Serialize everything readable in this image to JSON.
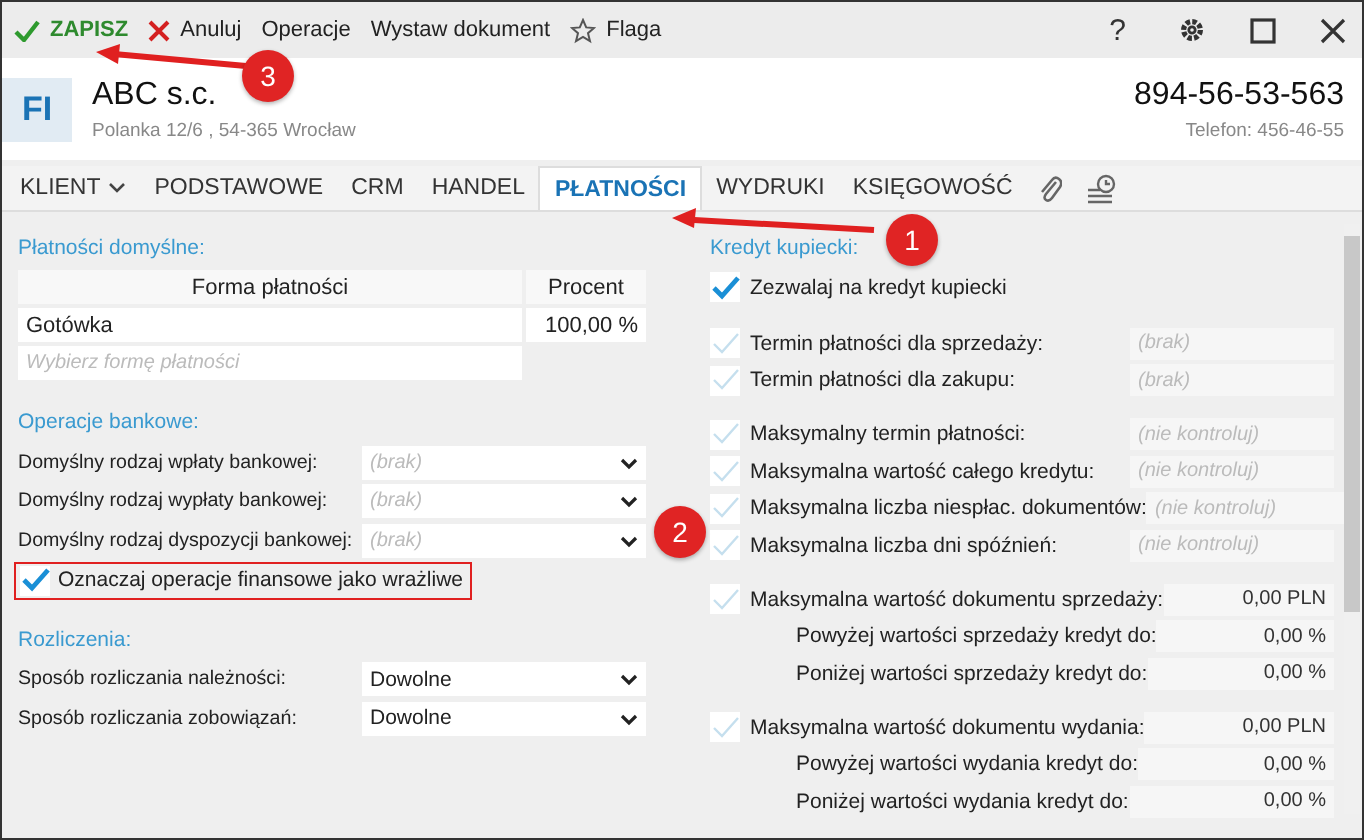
{
  "toolbar": {
    "items": [
      {
        "kind": "save",
        "label": "ZAPISZ"
      },
      {
        "kind": "cancel",
        "label": "Anuluj"
      },
      {
        "kind": "text",
        "label": "Operacje"
      },
      {
        "kind": "text",
        "label": "Wystaw dokument"
      },
      {
        "kind": "flag",
        "label": "Flaga"
      }
    ],
    "help": "?"
  },
  "header": {
    "initials": "FI",
    "name": "ABC s.c.",
    "address": "Polanka  12/6 , 54-365 Wrocław",
    "nip": "894-56-53-563",
    "phone": "Telefon: 456-46-55"
  },
  "tabs": [
    {
      "kind": "menu",
      "label": "KLIENT",
      "selected": false
    },
    {
      "kind": "text",
      "label": "PODSTAWOWE",
      "selected": false
    },
    {
      "kind": "text",
      "label": "CRM",
      "selected": false
    },
    {
      "kind": "text",
      "label": "HANDEL",
      "selected": false
    },
    {
      "kind": "text",
      "label": "PŁATNOŚCI",
      "selected": true
    },
    {
      "kind": "text",
      "label": "WYDRUKI",
      "selected": false
    },
    {
      "kind": "text",
      "label": "KSIĘGOWOŚĆ",
      "selected": false
    },
    {
      "kind": "attachment",
      "selected": false
    },
    {
      "kind": "history",
      "selected": false
    }
  ],
  "default_payments": {
    "title": "Płatności domyślne:",
    "columns": [
      "Forma płatności",
      "Procent"
    ],
    "rows": [
      {
        "method": "Gotówka",
        "percent": "100,00 %"
      }
    ],
    "placeholder": "Wybierz formę płatności"
  },
  "bank_operations": {
    "title": "Operacje bankowe:",
    "fields": [
      {
        "label": "Domyślny rodzaj wpłaty bankowej:",
        "placeholder": "(brak)"
      },
      {
        "label": "Domyślny rodzaj wypłaty bankowej:",
        "placeholder": "(brak)"
      },
      {
        "label": "Domyślny rodzaj dyspozycji bankowej:",
        "placeholder": "(brak)"
      }
    ],
    "sensitive": {
      "label": "Oznaczaj operacje finansowe jako wrażliwe",
      "checked": true,
      "highlighted": true
    }
  },
  "settlements": {
    "title": "Rozliczenia:",
    "fields": [
      {
        "label": "Sposób rozliczania należności:",
        "value": "Dowolne"
      },
      {
        "label": "Sposób rozliczania zobowiązań:",
        "value": "Dowolne"
      }
    ]
  },
  "credit": {
    "title": "Kredyt kupiecki:",
    "allow": {
      "label": "Zezwalaj na kredyt kupiecki",
      "checked": true
    },
    "groups": [
      [
        {
          "kind": "check",
          "label": "Termin płatności dla sprzedaży:",
          "checked": false,
          "placeholder": "(brak)"
        },
        {
          "kind": "check",
          "label": "Termin płatności dla zakupu:",
          "checked": false,
          "placeholder": "(brak)"
        }
      ],
      [
        {
          "kind": "check",
          "label": "Maksymalny termin płatności:",
          "checked": false,
          "placeholder": "(nie kontroluj)"
        },
        {
          "kind": "check",
          "label": "Maksymalna wartość całego kredytu:",
          "checked": false,
          "placeholder": "(nie kontroluj)"
        },
        {
          "kind": "check",
          "label": "Maksymalna liczba niespłac. dokumentów:",
          "checked": false,
          "placeholder": "(nie kontroluj)"
        },
        {
          "kind": "check",
          "label": "Maksymalna liczba dni spóźnień:",
          "checked": false,
          "placeholder": "(nie kontroluj)"
        }
      ],
      [
        {
          "kind": "check",
          "label": "Maksymalna wartość dokumentu sprzedaży:",
          "checked": false,
          "value": "0,00 PLN"
        },
        {
          "kind": "sub",
          "label": "Powyżej wartości sprzedaży kredyt do:",
          "value": "0,00 %"
        },
        {
          "kind": "sub",
          "label": "Poniżej wartości sprzedaży kredyt do:",
          "value": "0,00 %"
        }
      ],
      [
        {
          "kind": "check",
          "label": "Maksymalna wartość dokumentu wydania:",
          "checked": false,
          "value": "0,00 PLN"
        },
        {
          "kind": "sub",
          "label": "Powyżej wartości wydania kredyt do:",
          "value": "0,00 %"
        },
        {
          "kind": "sub",
          "label": "Poniżej wartości wydania kredyt do:",
          "value": "0,00 %"
        }
      ]
    ]
  },
  "annotations": [
    {
      "number": "3"
    },
    {
      "number": "1"
    },
    {
      "number": "2"
    }
  ]
}
